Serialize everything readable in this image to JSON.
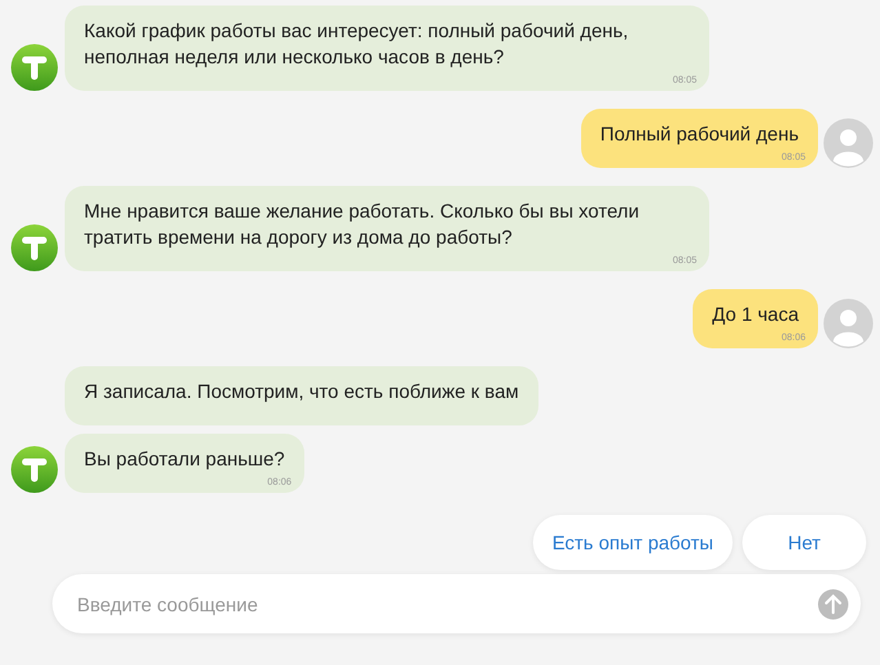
{
  "messages": [
    {
      "kind": "bot",
      "text": "Какой график работы вас интересует: полный рабочий день, неполная неделя или несколько часов в день?",
      "time": "08:05"
    },
    {
      "kind": "user",
      "text": "Полный рабочий день",
      "time": "08:05"
    },
    {
      "kind": "bot",
      "text": "Мне нравится ваше желание работать. Сколько бы вы хотели тратить времени на дорогу из дома до работы?",
      "time": "08:05"
    },
    {
      "kind": "user",
      "text": "До 1 часа",
      "time": "08:06"
    },
    {
      "kind": "bot",
      "text": "Я записала. Посмотрим, что есть поближе к вам"
    },
    {
      "kind": "bot",
      "text": "Вы работали раньше?",
      "time": "08:06"
    }
  ],
  "quick_replies": [
    "Есть опыт работы",
    "Нет"
  ],
  "input": {
    "placeholder": "Введите сообщение"
  }
}
